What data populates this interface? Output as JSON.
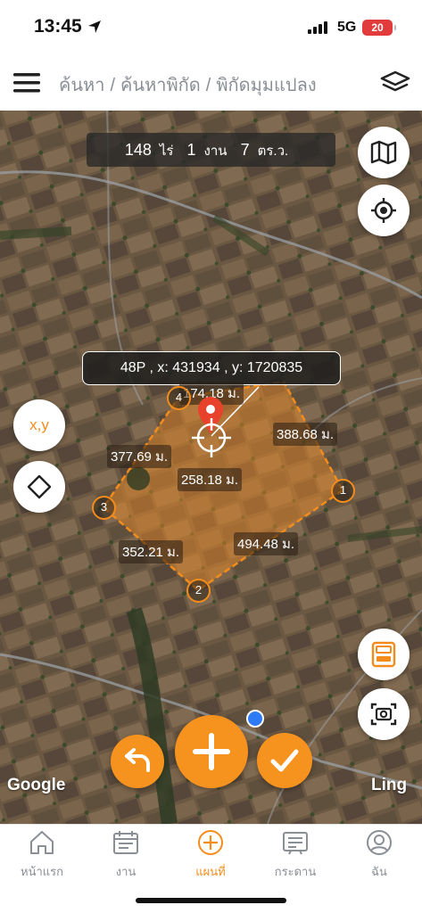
{
  "status_bar": {
    "time": "13:45",
    "network": "5G",
    "battery": "20"
  },
  "header": {
    "breadcrumb": [
      "ค้นหา",
      "ค้นหาพิกัด",
      "พิกัดมุมแปลง"
    ],
    "separator": "/"
  },
  "map": {
    "area": {
      "rai_value": "148",
      "rai_unit": "ไร่",
      "ngan_value": "1",
      "ngan_unit": "งาน",
      "wa_value": "7",
      "wa_unit": "ตร.ว."
    },
    "coordinate": "48P , x: 431934 , y: 1720835",
    "distances": {
      "side_4_top": "174.18 ม.",
      "side_1_4": "388.68 ม.",
      "side_3_4": "377.69 ม.",
      "diagonal": "258.18 ม.",
      "side_1_2": "494.48 ม.",
      "side_2_3": "352.21 ม."
    },
    "vertices": [
      "1",
      "2",
      "3",
      "4"
    ],
    "xy_button": "x,y",
    "google_label": "Google",
    "ling_label": "Ling"
  },
  "tabbar": {
    "items": [
      {
        "label": "หน้าแรก",
        "icon": "home-icon"
      },
      {
        "label": "งาน",
        "icon": "calendar-icon"
      },
      {
        "label": "แผนที่",
        "icon": "plus-circle-icon"
      },
      {
        "label": "กระดาน",
        "icon": "board-icon"
      },
      {
        "label": "ฉัน",
        "icon": "user-icon"
      }
    ],
    "active_index": 2
  },
  "colors": {
    "accent": "#f48c1c",
    "polygon_fill": "#e88a2a",
    "location_dot": "#2f7bf5"
  }
}
